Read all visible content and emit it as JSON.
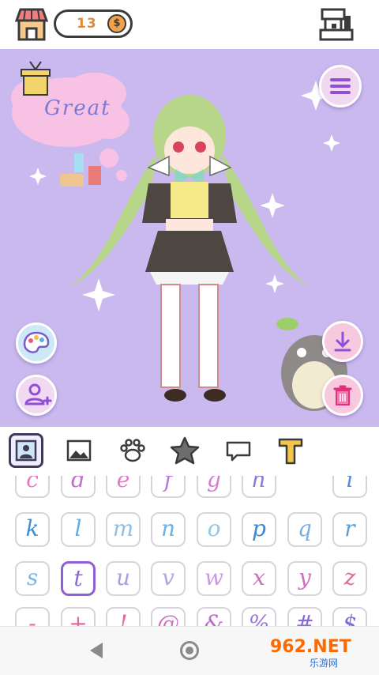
{
  "header": {
    "coin_count": "13",
    "coin_symbol": "$"
  },
  "stage": {
    "speech_bubble_text": "Great",
    "background_color": "#c9b9ef"
  },
  "tabs": [
    {
      "icon": "portrait-icon",
      "selected": true
    },
    {
      "icon": "image-icon",
      "selected": false
    },
    {
      "icon": "paw-icon",
      "selected": false
    },
    {
      "icon": "star-icon",
      "selected": false
    },
    {
      "icon": "speech-bubble-icon",
      "selected": false
    },
    {
      "icon": "text-icon",
      "selected": false
    }
  ],
  "keyboard": {
    "rows": [
      [
        {
          "char": "c",
          "color": "#e879c8"
        },
        {
          "char": "d",
          "color": "#c86bd6"
        },
        {
          "char": "e",
          "color": "#e879c8"
        },
        {
          "char": "f",
          "color": "#b57ad8"
        },
        {
          "char": "g",
          "color": "#d87ad0"
        },
        {
          "char": "h",
          "color": "#8a7ad8"
        },
        {
          "char": "i",
          "color": "#5a8ad6"
        }
      ],
      [
        {
          "char": "k",
          "color": "#3f8fd6"
        },
        {
          "char": "l",
          "color": "#5ab0e6"
        },
        {
          "char": "m",
          "color": "#8fc0e8"
        },
        {
          "char": "n",
          "color": "#6ab2e4"
        },
        {
          "char": "o",
          "color": "#8fc8e8"
        },
        {
          "char": "p",
          "color": "#3a8ad6"
        },
        {
          "char": "q",
          "color": "#7ab0e0"
        },
        {
          "char": "r",
          "color": "#5aa0d6"
        }
      ],
      [
        {
          "char": "s",
          "color": "#7ab8e6"
        },
        {
          "char": "t",
          "color": "#8a6ad8"
        },
        {
          "char": "u",
          "color": "#a8a0e0"
        },
        {
          "char": "v",
          "color": "#b0a8e4"
        },
        {
          "char": "w",
          "color": "#c89ae4"
        },
        {
          "char": "x",
          "color": "#d070b8"
        },
        {
          "char": "y",
          "color": "#d070c0"
        },
        {
          "char": "z",
          "color": "#e06a9a"
        }
      ],
      [
        {
          "char": "-",
          "color": "#e06aa0"
        },
        {
          "char": "+",
          "color": "#e06aa0"
        },
        {
          "char": "!",
          "color": "#e06aa0"
        },
        {
          "char": "@",
          "color": "#d070c0"
        },
        {
          "char": "&",
          "color": "#c06ad0"
        },
        {
          "char": "%",
          "color": "#a070d8"
        },
        {
          "char": "#",
          "color": "#8a6ad8"
        },
        {
          "char": "$",
          "color": "#7a70d8"
        }
      ]
    ],
    "selected_char": "t"
  },
  "watermark": {
    "brand": "962.NET",
    "sub": "乐游网"
  }
}
